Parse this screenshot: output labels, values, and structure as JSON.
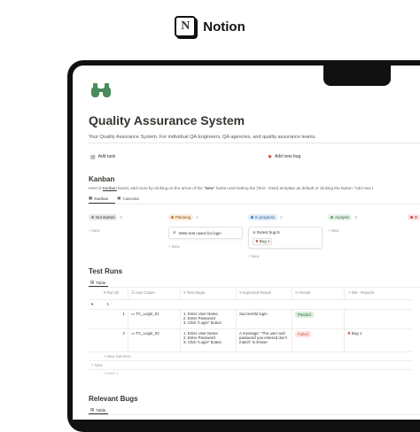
{
  "brand": {
    "logo_letter": "N",
    "name": "Notion"
  },
  "page": {
    "icon": "binoculars-icon",
    "icon_color": "#4a8a5c",
    "title": "Quality Assurance System",
    "description": "Your Quality Assurance System. For individual QA Engineers, QA agencies, and quality assurance teams."
  },
  "actions": {
    "add_task": "Add task",
    "add_bug": "Add new bug"
  },
  "kanban": {
    "heading": "Kanban",
    "desc_prefix": "Here is ",
    "desc_link": "Kanban",
    "desc_mid": " board, add more by clicking on the arrow of the \"",
    "desc_new": "New",
    "desc_suffix": "\" button and setting the [Test - Date] template as default or clicking the button \"Add new t",
    "tabs": [
      {
        "label": "Kanban"
      },
      {
        "label": "Calendar"
      }
    ],
    "columns": [
      {
        "label": "Not started",
        "count": "0",
        "bg": "#e9e9e7",
        "dot": "#91918e",
        "new": "+ New",
        "cards": []
      },
      {
        "label": "Planning",
        "count": "1",
        "bg": "#fbecdd",
        "dot": "#d9730d",
        "new": "+ New",
        "cards": [
          "Write test cases for login"
        ]
      },
      {
        "label": "In progress",
        "count": "1",
        "bg": "#e1ecf8",
        "dot": "#2f80ed",
        "new": "+ New",
        "cards": [
          "Retest bug N",
          "Bug 1"
        ]
      },
      {
        "label": "Analysis",
        "count": "0",
        "bg": "#e6f1e9",
        "dot": "#4dab6d",
        "new": "+ New",
        "cards": []
      },
      {
        "label": "D",
        "count": "",
        "bg": "#fbe4e4",
        "dot": "#e03e3e",
        "new": "",
        "cards": []
      }
    ]
  },
  "test_runs": {
    "heading": "Test Runs",
    "view": "Table",
    "headers": [
      "Run ID",
      "Use Cases",
      "Test Steps",
      "Expected Result",
      "Result",
      "DB - Reports"
    ],
    "group": "1",
    "rows": [
      {
        "id": "1",
        "use_case": "TC_Login_01",
        "steps": [
          "1. Enter User Name",
          "2. Enter Password",
          "3. Click \"Login\" button"
        ],
        "expected": "Successful login",
        "result": "Passed",
        "result_bg": "#dbeddb",
        "result_color": "#2b6b3c",
        "report": ""
      },
      {
        "id": "2",
        "use_case": "TC_Login_02",
        "steps": [
          "1. Enter User Name",
          "2. Enter Password",
          "3. Click \"Login\" button"
        ],
        "expected": "A message: \"The user and password you entered don't match\" is shown",
        "result": "Failed",
        "result_bg": "#ffe2dd",
        "result_color": "#c4554d",
        "report": "Bug 1"
      }
    ],
    "new_subitem": "+ New sub-item",
    "new": "+ New",
    "count_label": "COUNT 1"
  },
  "relevant_bugs": {
    "heading": "Relevant Bugs",
    "view": "Table"
  }
}
